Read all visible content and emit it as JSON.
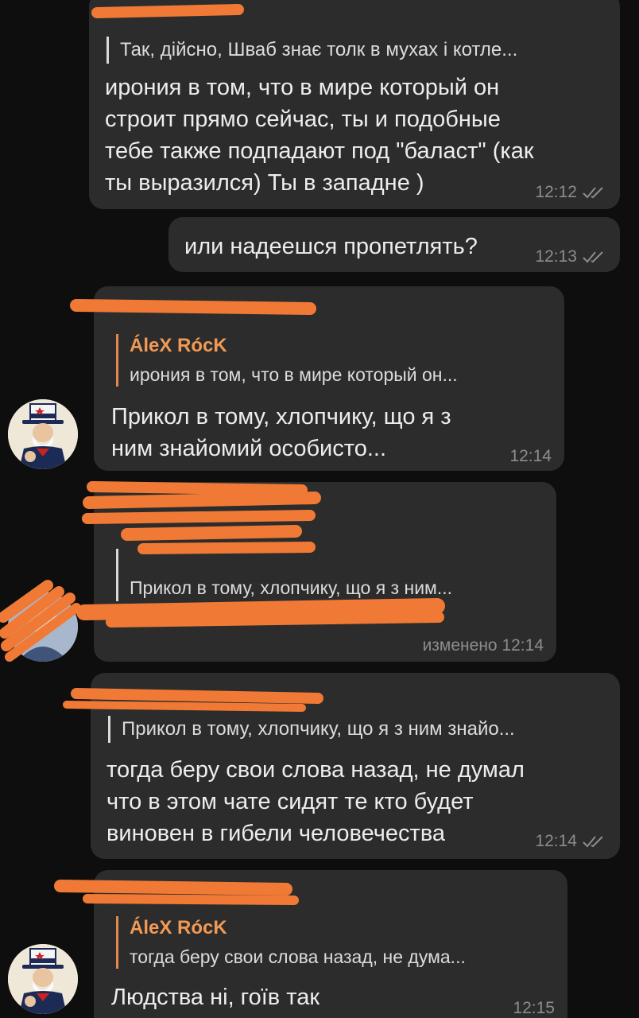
{
  "messages": [
    {
      "reply_text": "Так, дійсно, Шваб знає толк в мухах і котле...",
      "text_lines": [
        "ирония в том, что в мире который он",
        "строит прямо сейчас, ты и подобные",
        "тебе также подпадают под \"баласт\" (как",
        "ты выразился) Ты в западне )"
      ],
      "time": "12:12",
      "read": true
    },
    {
      "text": "или надеешся пропетлять?",
      "time": "12:13",
      "read": true
    },
    {
      "reply_name": "ÁleX RócK",
      "reply_text": "ирония в том, что в мире который он...",
      "text_lines": [
        "Прикол в тому, хлопчику, що я з",
        "ним знайомий особисто..."
      ],
      "time": "12:14"
    },
    {
      "reply_text": "Прикол в тому, хлопчику, що я з ним...",
      "time": "изменено 12:14"
    },
    {
      "reply_text": "Прикол в тому, хлопчику, що я з ним знайо...",
      "text_lines": [
        "тогда беру свои слова назад, не думал",
        "что в этом чате сидят те кто будет",
        "виновен в гибели человечества"
      ],
      "time": "12:14",
      "read": true
    },
    {
      "reply_name": "ÁleX RócK",
      "reply_text": "тогда беру свои слова назад, не дума...",
      "text": "Людства ні, гоїв так",
      "time": "12:15"
    }
  ],
  "colors": {
    "background": "#0e0e0e",
    "bubble": "#2c2c2c",
    "reply_name": "#f29a55",
    "redaction": "#f07a35",
    "time": "#8d8d8d"
  },
  "icons": [
    "double-check-icon",
    "avatar-uncle-sam"
  ]
}
